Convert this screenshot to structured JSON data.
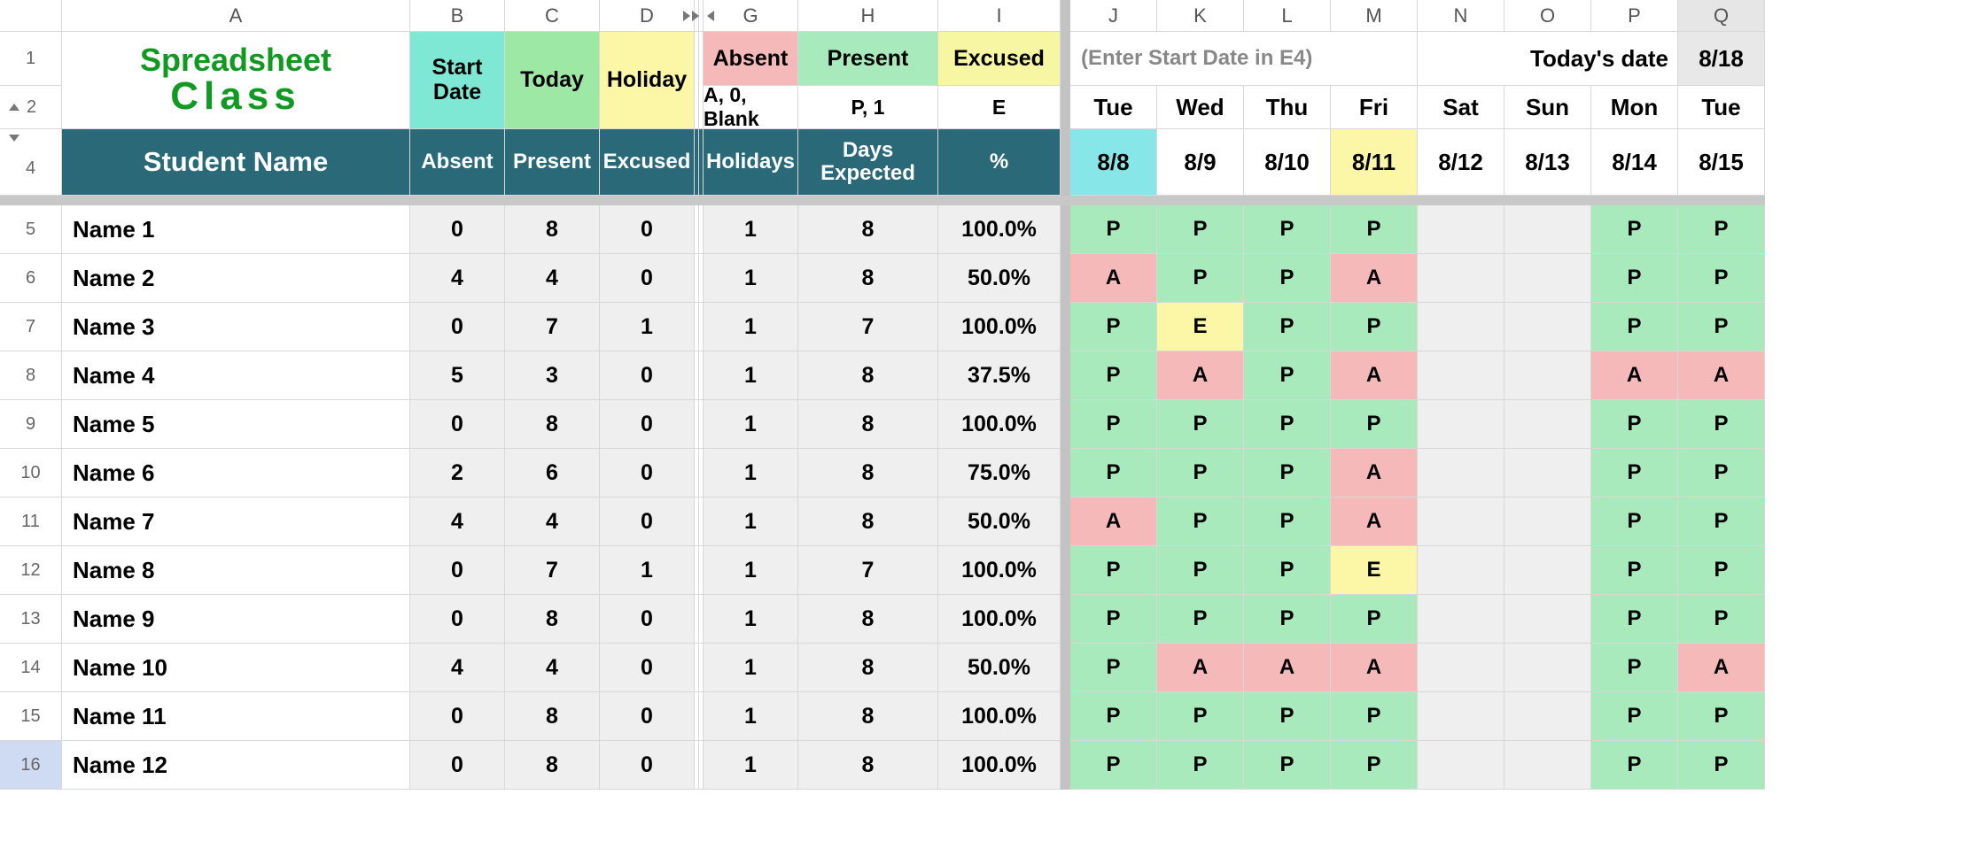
{
  "columns": [
    "A",
    "B",
    "C",
    "D",
    "G",
    "H",
    "I",
    "J",
    "K",
    "L",
    "M",
    "N",
    "O",
    "P",
    "Q"
  ],
  "rowNums": [
    "1",
    "2",
    "4",
    "5",
    "6",
    "7",
    "8",
    "9",
    "10",
    "11",
    "12",
    "13",
    "14",
    "15",
    "16"
  ],
  "logo": {
    "line1": "Spreadsheet",
    "line2": "Class"
  },
  "header1": {
    "startDate": "Start Date",
    "today": "Today",
    "holiday": "Holiday",
    "absent": "Absent",
    "present": "Present",
    "excused": "Excused",
    "hint": "(Enter Start Date in E4)",
    "todaysDate": "Today's date",
    "todaysDateVal": "8/18"
  },
  "header2": {
    "absentKey": "A, 0, Blank",
    "presentKey": "P, 1",
    "excusedKey": "E",
    "days": [
      "Tue",
      "Wed",
      "Thu",
      "Fri",
      "Sat",
      "Sun",
      "Mon",
      "Tue"
    ]
  },
  "header4": {
    "studentName": "Student Name",
    "cols": [
      "Absent",
      "Present",
      "Excused",
      "Holidays",
      "Days Expected",
      "%"
    ],
    "dates": [
      "8/8",
      "8/9",
      "8/10",
      "8/11",
      "8/12",
      "8/13",
      "8/14",
      "8/15"
    ]
  },
  "rows": [
    {
      "name": "Name 1",
      "vals": [
        "0",
        "8",
        "0",
        "1",
        "8",
        "100.0%"
      ],
      "att": [
        "P",
        "P",
        "P",
        "P",
        "",
        "",
        "P",
        "P"
      ]
    },
    {
      "name": "Name 2",
      "vals": [
        "4",
        "4",
        "0",
        "1",
        "8",
        "50.0%"
      ],
      "att": [
        "A",
        "P",
        "P",
        "A",
        "",
        "",
        "P",
        "P"
      ]
    },
    {
      "name": "Name 3",
      "vals": [
        "0",
        "7",
        "1",
        "1",
        "7",
        "100.0%"
      ],
      "att": [
        "P",
        "E",
        "P",
        "P",
        "",
        "",
        "P",
        "P"
      ]
    },
    {
      "name": "Name 4",
      "vals": [
        "5",
        "3",
        "0",
        "1",
        "8",
        "37.5%"
      ],
      "att": [
        "P",
        "A",
        "P",
        "A",
        "",
        "",
        "A",
        "A"
      ]
    },
    {
      "name": "Name 5",
      "vals": [
        "0",
        "8",
        "0",
        "1",
        "8",
        "100.0%"
      ],
      "att": [
        "P",
        "P",
        "P",
        "P",
        "",
        "",
        "P",
        "P"
      ]
    },
    {
      "name": "Name 6",
      "vals": [
        "2",
        "6",
        "0",
        "1",
        "8",
        "75.0%"
      ],
      "att": [
        "P",
        "P",
        "P",
        "A",
        "",
        "",
        "P",
        "P"
      ]
    },
    {
      "name": "Name 7",
      "vals": [
        "4",
        "4",
        "0",
        "1",
        "8",
        "50.0%"
      ],
      "att": [
        "A",
        "P",
        "P",
        "A",
        "",
        "",
        "P",
        "P"
      ]
    },
    {
      "name": "Name 8",
      "vals": [
        "0",
        "7",
        "1",
        "1",
        "7",
        "100.0%"
      ],
      "att": [
        "P",
        "P",
        "P",
        "E",
        "",
        "",
        "P",
        "P"
      ]
    },
    {
      "name": "Name 9",
      "vals": [
        "0",
        "8",
        "0",
        "1",
        "8",
        "100.0%"
      ],
      "att": [
        "P",
        "P",
        "P",
        "P",
        "",
        "",
        "P",
        "P"
      ]
    },
    {
      "name": "Name 10",
      "vals": [
        "4",
        "4",
        "0",
        "1",
        "8",
        "50.0%"
      ],
      "att": [
        "P",
        "A",
        "A",
        "A",
        "",
        "",
        "P",
        "A"
      ]
    },
    {
      "name": "Name 11",
      "vals": [
        "0",
        "8",
        "0",
        "1",
        "8",
        "100.0%"
      ],
      "att": [
        "P",
        "P",
        "P",
        "P",
        "",
        "",
        "P",
        "P"
      ]
    },
    {
      "name": "Name 12",
      "vals": [
        "0",
        "8",
        "0",
        "1",
        "8",
        "100.0%"
      ],
      "att": [
        "P",
        "P",
        "P",
        "P",
        "",
        "",
        "P",
        "P"
      ]
    }
  ]
}
